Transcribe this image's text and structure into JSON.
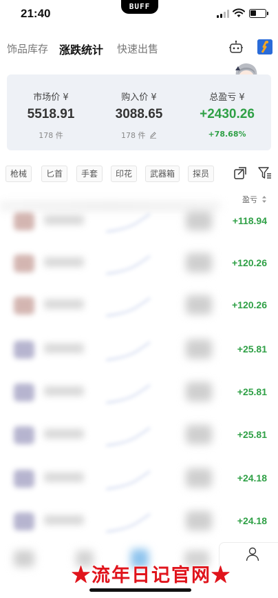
{
  "status_bar": {
    "time": "21:40",
    "island_text": "BUFF",
    "icons": [
      "cellular-signal-icon",
      "wifi-icon",
      "battery-icon"
    ]
  },
  "top_nav": {
    "tabs": [
      {
        "label": "饰品库存",
        "active": false
      },
      {
        "label": "涨跌统计",
        "active": true
      },
      {
        "label": "快速出售",
        "active": false
      }
    ],
    "icons": [
      "robot-icon",
      "app-icon"
    ]
  },
  "summary": {
    "market": {
      "label": "市场价 ¥",
      "value": "5518.91",
      "sub": "178 件"
    },
    "purchase": {
      "label": "购入价 ¥",
      "value": "3088.65",
      "sub": "178 件"
    },
    "profit": {
      "label": "总盈亏 ¥",
      "value": "+2430.26",
      "sub": "+78.68%"
    }
  },
  "filters": {
    "chips": [
      "枪械",
      "匕首",
      "手套",
      "印花",
      "武器箱",
      "探员"
    ],
    "icons": [
      "export-icon",
      "filter-icon"
    ]
  },
  "table": {
    "profit_header": "盈亏",
    "rows": [
      {
        "profit": "+118.94"
      },
      {
        "profit": "+120.26"
      },
      {
        "profit": "+120.26"
      },
      {
        "profit": "+25.81"
      },
      {
        "profit": "+25.81"
      },
      {
        "profit": "+25.81"
      },
      {
        "profit": "+24.18"
      },
      {
        "profit": "+24.18"
      }
    ]
  },
  "watermark": "★流年日记官网★",
  "colors": {
    "profit_green": "#2fa046",
    "watermark_red": "#e0141c",
    "summary_bg": "#eef1f6"
  }
}
